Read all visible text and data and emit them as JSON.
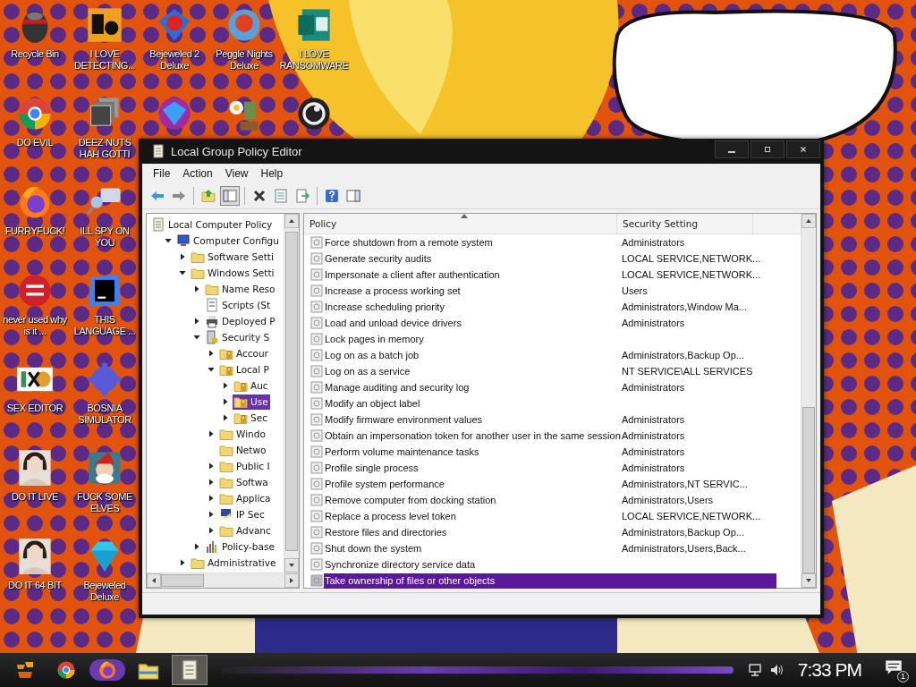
{
  "desktop_columns": [
    {
      "icons": [
        {
          "label": "Recycle Bin",
          "kind": "bin"
        },
        {
          "label": "DO EVIL",
          "kind": "chrome"
        },
        {
          "label": "FURRYFUCK!",
          "kind": "firefox"
        },
        {
          "label": "never used why is it ...",
          "kind": "devc"
        },
        {
          "label": "SEX EDITOR",
          "kind": "hxd"
        },
        {
          "label": "DO IT LIVE",
          "kind": "portrait"
        },
        {
          "label": "DO IT 64 BIT",
          "kind": "portrait"
        }
      ]
    },
    {
      "icons": [
        {
          "label": "I LOVE DETECTING...",
          "kind": "de"
        },
        {
          "label": "DEEZ NUTS HAH GOTTI",
          "kind": "stack"
        },
        {
          "label": "ILL SPY ON YOU",
          "kind": "spy"
        },
        {
          "label": "THIS LANGUAGE ...",
          "kind": "go"
        },
        {
          "label": "BOSNIA SIMULATOR",
          "kind": "mine"
        },
        {
          "label": "FUCK SOME ELVES",
          "kind": "elf"
        },
        {
          "label": "Bejeweled Deluxe",
          "kind": "diamond"
        }
      ]
    },
    {
      "icons": [
        {
          "label": "Bejeweled 2 Deluxe",
          "kind": "gem2"
        },
        {
          "kind": "gem"
        }
      ]
    },
    {
      "icons": [
        {
          "label": "Peggle Nights Deluxe",
          "kind": "peggle"
        },
        {
          "kind": "plant"
        }
      ]
    },
    {
      "icons": [
        {
          "label": "I LOVE RANSOMWARE",
          "kind": "publisher"
        },
        {
          "kind": "creature"
        }
      ]
    }
  ],
  "window": {
    "title": "Local Group Policy Editor",
    "menu": [
      "File",
      "Action",
      "View",
      "Help"
    ],
    "toolbar": [
      {
        "kind": "back",
        "pressed": false
      },
      {
        "kind": "forward",
        "pressed": false
      },
      {
        "kind": "separator"
      },
      {
        "kind": "up",
        "pressed": false
      },
      {
        "kind": "tree-toggle",
        "pressed": true
      },
      {
        "kind": "separator"
      },
      {
        "kind": "delete",
        "pressed": false
      },
      {
        "kind": "properties",
        "pressed": false
      },
      {
        "kind": "export",
        "pressed": false
      },
      {
        "kind": "separator"
      },
      {
        "kind": "help",
        "pressed": false
      },
      {
        "kind": "action-pane",
        "pressed": false
      }
    ],
    "tree": [
      {
        "label": "Local Computer Policy",
        "kind": "scroll",
        "selected": false,
        "children": [
          {
            "label": "Computer Configu",
            "kind": "computer",
            "expanded": true,
            "selected": false,
            "children": [
              {
                "label": "Software Setti",
                "kind": "folder",
                "expanded": false,
                "selected": false
              },
              {
                "label": "Windows Setti",
                "kind": "folder",
                "expanded": true,
                "selected": false,
                "children": [
                  {
                    "label": "Name Reso",
                    "kind": "folder",
                    "expanded": false,
                    "selected": false
                  },
                  {
                    "label": "Scripts (St",
                    "kind": "script",
                    "selected": false
                  },
                  {
                    "label": "Deployed P",
                    "kind": "printer",
                    "expanded": false,
                    "selected": false
                  },
                  {
                    "label": "Security S",
                    "kind": "security",
                    "expanded": true,
                    "selected": false,
                    "children": [
                      {
                        "label": "Accour",
                        "kind": "locked-folder",
                        "expanded": false,
                        "selected": false
                      },
                      {
                        "label": "Local P",
                        "kind": "locked-folder",
                        "expanded": true,
                        "selected": false,
                        "children": [
                          {
                            "label": "Auc",
                            "kind": "locked-folder",
                            "expanded": false,
                            "selected": false
                          },
                          {
                            "label": "Use",
                            "kind": "locked-folder",
                            "expanded": false,
                            "selected": true
                          },
                          {
                            "label": "Sec",
                            "kind": "locked-folder",
                            "expanded": false,
                            "selected": false
                          }
                        ]
                      },
                      {
                        "label": "Windo",
                        "kind": "folder",
                        "expanded": false,
                        "selected": false
                      },
                      {
                        "label": "Netwo",
                        "kind": "folder",
                        "selected": false
                      },
                      {
                        "label": "Public I",
                        "kind": "folder",
                        "expanded": false,
                        "selected": false
                      },
                      {
                        "label": "Softwa",
                        "kind": "folder",
                        "expanded": false,
                        "selected": false
                      },
                      {
                        "label": "Applica",
                        "kind": "folder",
                        "expanded": false,
                        "selected": false
                      },
                      {
                        "label": "IP Sec",
                        "kind": "network",
                        "expanded": false,
                        "selected": false
                      },
                      {
                        "label": "Advanc",
                        "kind": "folder",
                        "expanded": false,
                        "selected": false
                      }
                    ]
                  },
                  {
                    "label": "Policy-base",
                    "kind": "chart",
                    "expanded": false,
                    "selected": false
                  }
                ]
              },
              {
                "label": "Administrative",
                "kind": "folder",
                "expanded": false,
                "selected": false
              }
            ]
          }
        ]
      }
    ],
    "list": {
      "columns": [
        {
          "label": "Policy",
          "sorted": true
        },
        {
          "label": "Security Setting",
          "sorted": false
        }
      ],
      "rows": [
        {
          "policy": "Force shutdown from a remote system",
          "setting": "Administrators",
          "selected": false
        },
        {
          "policy": "Generate security audits",
          "setting": "LOCAL SERVICE,NETWORK...",
          "selected": false
        },
        {
          "policy": "Impersonate a client after authentication",
          "setting": "LOCAL SERVICE,NETWORK...",
          "selected": false
        },
        {
          "policy": "Increase a process working set",
          "setting": "Users",
          "selected": false
        },
        {
          "policy": "Increase scheduling priority",
          "setting": "Administrators,Window Ma...",
          "selected": false
        },
        {
          "policy": "Load and unload device drivers",
          "setting": "Administrators",
          "selected": false
        },
        {
          "policy": "Lock pages in memory",
          "selected": false
        },
        {
          "policy": "Log on as a batch job",
          "setting": "Administrators,Backup Op...",
          "selected": false
        },
        {
          "policy": "Log on as a service",
          "setting": "NT SERVICE\\ALL SERVICES",
          "selected": false
        },
        {
          "policy": "Manage auditing and security log",
          "setting": "Administrators",
          "selected": false
        },
        {
          "policy": "Modify an object label",
          "selected": false
        },
        {
          "policy": "Modify firmware environment values",
          "setting": "Administrators",
          "selected": false
        },
        {
          "policy": "Obtain an impersonation token for another user in the same session",
          "setting": "Administrators",
          "selected": false
        },
        {
          "policy": "Perform volume maintenance tasks",
          "setting": "Administrators",
          "selected": false
        },
        {
          "policy": "Profile single process",
          "setting": "Administrators",
          "selected": false
        },
        {
          "policy": "Profile system performance",
          "setting": "Administrators,NT SERVIC...",
          "selected": false
        },
        {
          "policy": "Remove computer from docking station",
          "setting": "Administrators,Users",
          "selected": false
        },
        {
          "policy": "Replace a process level token",
          "setting": "LOCAL SERVICE,NETWORK...",
          "selected": false
        },
        {
          "policy": "Restore files and directories",
          "setting": "Administrators,Backup Op...",
          "selected": false
        },
        {
          "policy": "Shut down the system",
          "setting": "Administrators,Users,Back...",
          "selected": false
        },
        {
          "policy": "Synchronize directory service data",
          "selected": false
        },
        {
          "policy": "Take ownership of files or other objects",
          "selected": true
        }
      ]
    }
  },
  "taskbar": {
    "items": [
      {
        "kind": "start",
        "active": false
      },
      {
        "kind": "chrome",
        "active": false
      },
      {
        "kind": "firefox",
        "active": false
      },
      {
        "kind": "explorer",
        "active": false
      },
      {
        "kind": "policy-editor",
        "active": true
      }
    ],
    "clock": "7:33 PM",
    "notification_count": "1"
  }
}
